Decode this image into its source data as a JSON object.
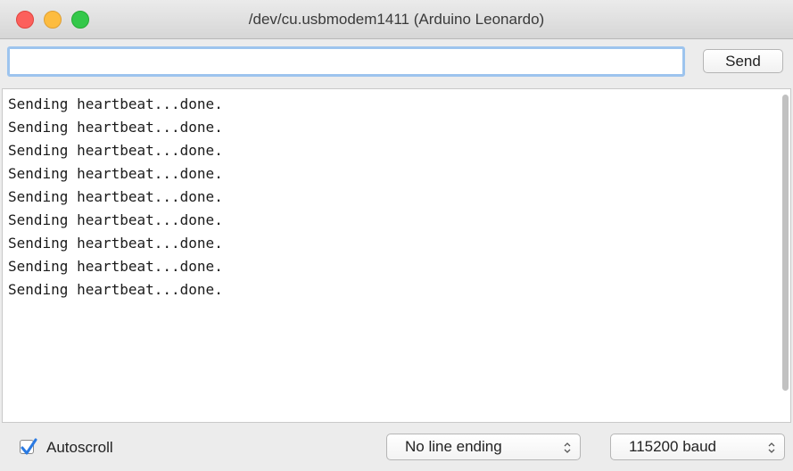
{
  "window": {
    "title": "/dev/cu.usbmodem1411 (Arduino Leonardo)"
  },
  "input_bar": {
    "send_field_value": "",
    "send_button_label": "Send"
  },
  "console": {
    "lines": [
      "Sending heartbeat...done.",
      "Sending heartbeat...done.",
      "Sending heartbeat...done.",
      "Sending heartbeat...done.",
      "Sending heartbeat...done.",
      "Sending heartbeat...done.",
      "Sending heartbeat...done.",
      "Sending heartbeat...done.",
      "Sending heartbeat...done."
    ]
  },
  "bottom_bar": {
    "autoscroll_label": "Autoscroll",
    "autoscroll_checked": true,
    "line_ending_selected": "No line ending",
    "baud_selected": "115200 baud"
  },
  "colors": {
    "close": "#fc605c",
    "minimize": "#fdbc40",
    "maximize": "#34c84a",
    "focus_ring": "#9dc4ee",
    "checkmark": "#2a7ae2"
  },
  "icons": {
    "close": "close-button-icon",
    "minimize": "minimize-button-icon",
    "maximize": "zoom-button-icon",
    "checkbox": "checkmark-icon",
    "popup": "updown-chevron-icon"
  }
}
